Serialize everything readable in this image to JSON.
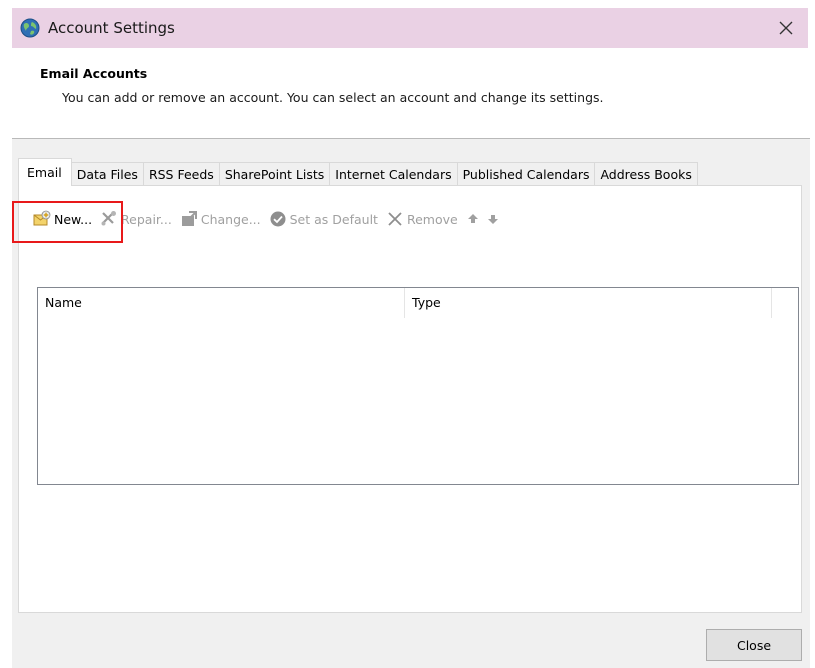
{
  "window": {
    "title": "Account Settings",
    "titlebar_color": "#ead1e4"
  },
  "header": {
    "heading": "Email Accounts",
    "description": "You can add or remove an account. You can select an account and change its settings."
  },
  "tabs": [
    {
      "label": "Email",
      "active": true
    },
    {
      "label": "Data Files",
      "active": false
    },
    {
      "label": "RSS Feeds",
      "active": false
    },
    {
      "label": "SharePoint Lists",
      "active": false
    },
    {
      "label": "Internet Calendars",
      "active": false
    },
    {
      "label": "Published Calendars",
      "active": false
    },
    {
      "label": "Address Books",
      "active": false
    }
  ],
  "toolbar": {
    "new_label": "New...",
    "repair_label": "Repair...",
    "change_label": "Change...",
    "set_default_label": "Set as Default",
    "remove_label": "Remove",
    "highlight_color": "#e8191a"
  },
  "list": {
    "columns": [
      "Name",
      "Type"
    ],
    "rows": []
  },
  "footer": {
    "close_label": "Close"
  },
  "icons": {
    "app": "outlook-globe-icon",
    "close": "close-icon",
    "new": "new-account-icon",
    "repair": "repair-icon",
    "change": "change-icon",
    "set_default": "checkmark-circle-icon",
    "remove": "remove-x-icon",
    "move_up": "arrow-up-icon",
    "move_down": "arrow-down-icon"
  }
}
